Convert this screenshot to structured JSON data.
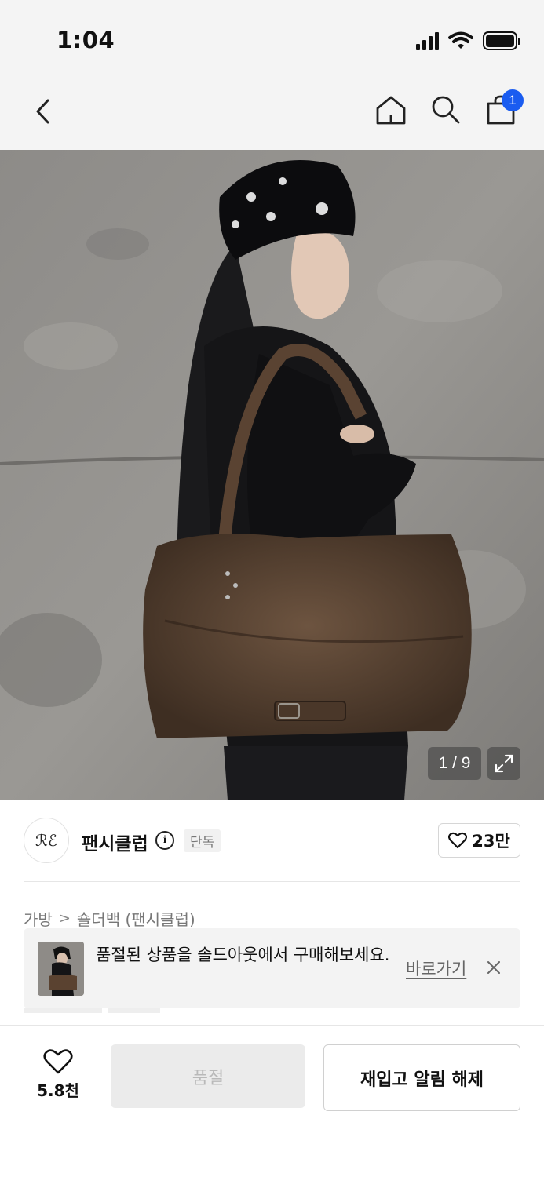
{
  "status_bar": {
    "time": "1:04"
  },
  "nav": {
    "back_icon": "chevron-left-icon",
    "home_icon": "home-icon",
    "search_icon": "search-icon",
    "cart_icon": "shopping-bag-icon",
    "cart_badge": "1",
    "badge_color": "#1a5cf0"
  },
  "product_image": {
    "counter": "1 / 9",
    "expand_icon": "expand-icon"
  },
  "brand": {
    "logo_text": "ℛℰ",
    "name": "팬시클럽",
    "info_icon": "i",
    "badge": "단독",
    "like_count": "23만"
  },
  "breadcrumb": {
    "category": "가방",
    "separator": ">",
    "subcategory": "숄더백 (팬시클럽)"
  },
  "toast": {
    "message": "품절된 상품을 솔드아웃에서 구매해보세요.",
    "link_label": "바로가기"
  },
  "bottom_bar": {
    "wish_count": "5.8천",
    "soldout_label": "품절",
    "notify_label": "재입고 알림 해제"
  }
}
